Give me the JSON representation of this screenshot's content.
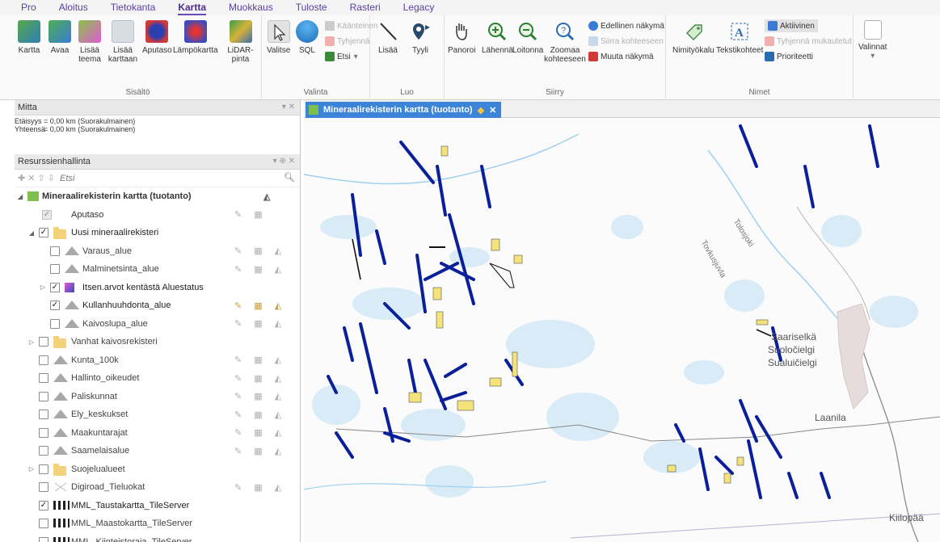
{
  "menu": {
    "tabs": [
      {
        "label": "Pro"
      },
      {
        "label": "Aloitus"
      },
      {
        "label": "Tietokanta"
      },
      {
        "label": "Kartta"
      },
      {
        "label": "Muokkaus"
      },
      {
        "label": "Tuloste"
      },
      {
        "label": "Rasteri"
      },
      {
        "label": "Legacy"
      }
    ],
    "active": "Kartta"
  },
  "ribbon": {
    "sisalto": {
      "label": "Sisältö",
      "kartta": "Kartta",
      "avaa": "Avaa",
      "lisaa_teema": "Lisää teema",
      "lisaa_karttaan": "Lisää karttaan",
      "aputaso": "Aputaso",
      "lampokartta": "Lämpökartta",
      "lidar": "LiDAR-pinta"
    },
    "valinta": {
      "label": "Valinta",
      "valitse": "Valitse",
      "sql": "SQL",
      "kaanteinen": "Käänteinen",
      "tyhjenna": "Tyhjennä",
      "etsi": "Etsi"
    },
    "luo": {
      "label": "Luo",
      "lisaa": "Lisää",
      "tyyli": "Tyyli"
    },
    "siirry": {
      "label": "Siirry",
      "panoroi": "Panoroi",
      "lahenna": "Lähennä",
      "loitonna": "Loitonna",
      "zoomaa": "Zoomaa kohteeseen",
      "edellinen": "Edellinen näkymä",
      "siirra": "Siirra kohteeseen",
      "muuta": "Muuta näkymä"
    },
    "nimet": {
      "label": "Nimet",
      "nimityokalu": "Nimityökalu",
      "tekstikohteet": "Tekstikohteet",
      "aktiivinen": "Aktiivinen",
      "tyhjenna_muokatut": "Tyhjennä mukautetut",
      "prioriteetti": "Prioriteetti"
    },
    "valinnat": {
      "label": "Valinnat"
    }
  },
  "mitta": {
    "title": "Mitta",
    "etaisyys_label": "Etäisyys",
    "etaisyys_value": "= 0,00 km (Suorakulmainen)",
    "yhteensa_label": "Yhteensä",
    "yhteensa_value": "= 0,00 km (Suorakulmainen)"
  },
  "resurssit": {
    "title": "Resurssienhallinta",
    "search_placeholder": "Etsi",
    "root": "Mineraalirekisterin kartta (tuotanto)",
    "items": [
      {
        "name": "Aputaso",
        "checked": true,
        "disabled": true,
        "icon": "none"
      },
      {
        "name": "Uusi mineraalirekisteri",
        "checked": true,
        "icon": "folder-icon"
      },
      {
        "name": "Varaus_alue",
        "checked": false,
        "icon": "polygon-icon"
      },
      {
        "name": "Malminetsinta_alue",
        "checked": false,
        "icon": "polygon-icon"
      },
      {
        "name": "Itsen.arvot kentästä Aluestatus",
        "checked": true,
        "icon": "theme-icon"
      },
      {
        "name": "Kullanhuuhdonta_alue",
        "checked": true,
        "icon": "polygon-icon"
      },
      {
        "name": "Kaivoslupa_alue",
        "checked": false,
        "icon": "polygon-icon"
      },
      {
        "name": "Vanhat kaivosrekisteri",
        "checked": false,
        "icon": "folder-icon"
      },
      {
        "name": "Kunta_100k",
        "checked": false,
        "icon": "polygon-icon"
      },
      {
        "name": "Hallinto_oikeudet",
        "checked": false,
        "icon": "polygon-icon"
      },
      {
        "name": "Paliskunnat",
        "checked": false,
        "icon": "polygon-icon"
      },
      {
        "name": "Ely_keskukset",
        "checked": false,
        "icon": "polygon-icon"
      },
      {
        "name": "Maakuntarajat",
        "checked": false,
        "icon": "polygon-icon"
      },
      {
        "name": "Saamelaisalue",
        "checked": false,
        "icon": "polygon-icon"
      },
      {
        "name": "Suojelualueet",
        "checked": false,
        "icon": "folder-icon"
      },
      {
        "name": "Digiroad_Tieluokat",
        "checked": false,
        "icon": "line-icon"
      },
      {
        "name": "MML_Taustakartta_TileServer",
        "checked": true,
        "icon": "tile-icon"
      },
      {
        "name": "MML_Maastokartta_TileServer",
        "checked": false,
        "icon": "tile-icon"
      },
      {
        "name": "MML_Kiinteistoraja_TileServer",
        "checked": false,
        "icon": "tile-icon"
      }
    ]
  },
  "map": {
    "tab_title": "Mineraalirekisterin kartta (tuotanto)",
    "places": {
      "saariselka": "Saariselkä",
      "suoloc": "Suoločielgi",
      "sualu": "Sualuičielgi",
      "laanila": "Laanila",
      "kiilopaa": "Kiilopää",
      "tolosjoki": "Tolosjoki",
      "tovkusjuvla": "Tovkusjuvla"
    },
    "colors": {
      "claims_blue": "#0a1f9a",
      "claims_yellow": "#f3e37a",
      "water": "#cfe7f5",
      "roads": "#8a8a8a"
    }
  }
}
